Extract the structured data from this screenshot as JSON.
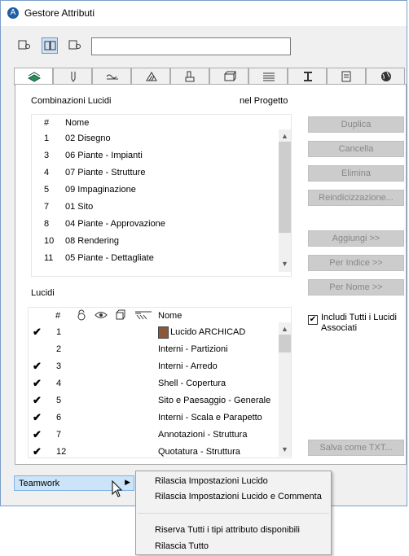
{
  "window": {
    "title": "Gestore Attributi"
  },
  "toolbar": {
    "search_value": ""
  },
  "tabs": [
    "layers-icon",
    "pen-icon",
    "line-icon",
    "fill-icon",
    "building-material-icon",
    "composite-icon",
    "profile-icon",
    "zone-icon",
    "markup-icon",
    "globe-icon"
  ],
  "combinations": {
    "label": "Combinazioni Lucidi",
    "scope_label": "nel Progetto",
    "headers": {
      "num": "#",
      "name": "Nome"
    },
    "rows": [
      {
        "num": "1",
        "name": "02 Disegno"
      },
      {
        "num": "3",
        "name": "06 Piante - Impianti"
      },
      {
        "num": "4",
        "name": "07 Piante - Strutture"
      },
      {
        "num": "5",
        "name": "09 Impaginazione"
      },
      {
        "num": "7",
        "name": "01 Sito"
      },
      {
        "num": "8",
        "name": "04 Piante - Approvazione"
      },
      {
        "num": "10",
        "name": "08 Rendering"
      },
      {
        "num": "11",
        "name": "05 Piante - Dettagliate"
      }
    ]
  },
  "layers": {
    "label": "Lucidi",
    "headers": {
      "num": "#",
      "name": "Nome"
    },
    "rows": [
      {
        "check": "✔",
        "num": "1",
        "name": "Lucido ARCHICAD"
      },
      {
        "check": "",
        "num": "2",
        "name": "Interni - Partizioni"
      },
      {
        "check": "✔",
        "num": "3",
        "name": "Interni - Arredo"
      },
      {
        "check": "✔",
        "num": "4",
        "name": "Shell - Copertura"
      },
      {
        "check": "✔",
        "num": "5",
        "name": "Sito e Paesaggio - Generale"
      },
      {
        "check": "✔",
        "num": "6",
        "name": "Interni - Scala e Parapetto"
      },
      {
        "check": "✔",
        "num": "7",
        "name": "Annotazioni - Struttura"
      },
      {
        "check": "✔",
        "num": "12",
        "name": "Quotatura - Struttura"
      }
    ]
  },
  "buttons": {
    "duplica": "Duplica",
    "cancella": "Cancella",
    "elimina": "Elimina",
    "reindicizza": "Reindicizzazione...",
    "aggiungi": "Aggiungi >>",
    "per_indice": "Per Indice >>",
    "per_nome": "Per Nome >>",
    "salva": "Salva come TXT..."
  },
  "include_all": {
    "label": "Includi Tutti i Lucidi Associati",
    "checked": true
  },
  "teamwork": {
    "label": "Teamwork"
  },
  "context_menu": {
    "items": [
      "Rilascia Impostazioni Lucido",
      "Rilascia Impostazioni Lucido e Commenta",
      "Riserva Tutti i tipi attributo disponibili",
      "Rilascia Tutto"
    ]
  }
}
